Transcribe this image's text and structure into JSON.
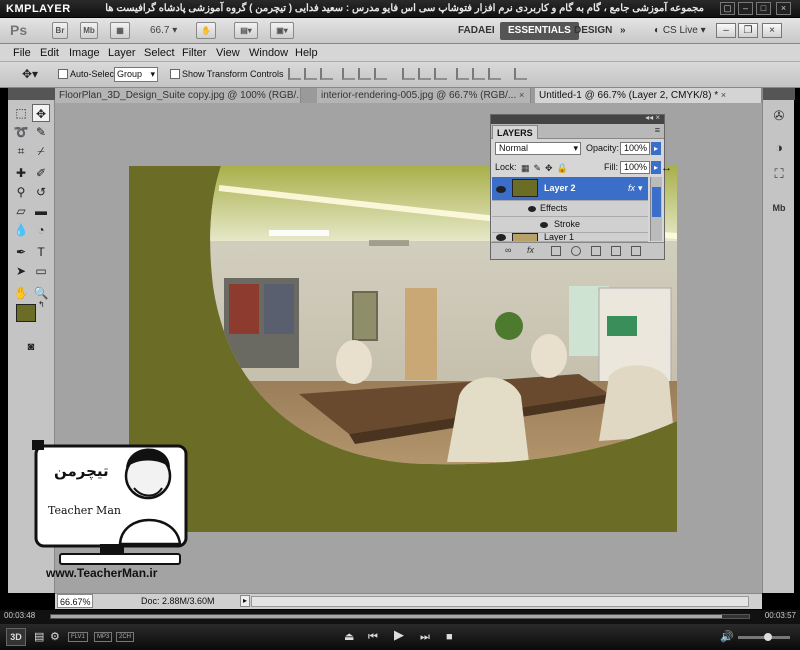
{
  "player": {
    "logo": "KMPLAYER",
    "caption": "مجموعه آموزشی جامع ، گام به گام و کاربردی نرم افزار فتوشاپ سی اس فایو  مدرس : سعید فدایی ( تیچرمن ) گروه آموزشی پادشاه گرافیست ها",
    "win_buttons": [
      "▢",
      "–",
      "□",
      "×"
    ],
    "time_elapsed": "00:03:48",
    "time_total": "00:03:57",
    "badges": [
      "FLV1",
      "MP3",
      "2CH"
    ]
  },
  "app": {
    "logo": "Ps",
    "chip_br": "Br",
    "chip_mb": "Mb",
    "zoom_drop": "66.7",
    "workspaces": [
      "FADAEI",
      "ESSENTIALS",
      "DESIGN"
    ],
    "more": "»",
    "cslive": "CS Live"
  },
  "menu": [
    "File",
    "Edit",
    "Image",
    "Layer",
    "Select",
    "Filter",
    "View",
    "Window",
    "Help"
  ],
  "options": {
    "auto_select": "Auto-Select:",
    "group_value": "Group",
    "show_transform": "Show Transform Controls"
  },
  "tabs": [
    {
      "label": "FloorPlan_3D_Design_Suite copy.jpg @ 100% (RGB/...",
      "close": "×"
    },
    {
      "label": "interior-rendering-005.jpg @ 66.7% (RGB/...",
      "close": "×"
    },
    {
      "label": "Untitled-1 @ 66.7% (Layer 2, CMYK/8) *",
      "close": "×"
    }
  ],
  "layers": {
    "tab": "LAYERS",
    "blend": "Normal",
    "opacity_label": "Opacity:",
    "opacity_value": "100%",
    "lock_label": "Lock:",
    "fill_label": "Fill:",
    "fill_value": "100%",
    "rows": [
      {
        "name": "Layer 2",
        "fx": "fx"
      },
      {
        "name": "Effects"
      },
      {
        "name": "Stroke"
      },
      {
        "name": "Layer 1"
      }
    ]
  },
  "status": {
    "zoom": "66.67%",
    "doc": "Doc: 2.88M/3.60M"
  },
  "watermark": {
    "brand_fa": "تیچرمن",
    "brand_en": "Teacher Man",
    "url": "www.TeacherMan.ir"
  },
  "colors": {
    "canvas_olive": "#6b6d27",
    "foreground": "#6b6d27",
    "layer_selected": "#3a6ec8"
  }
}
